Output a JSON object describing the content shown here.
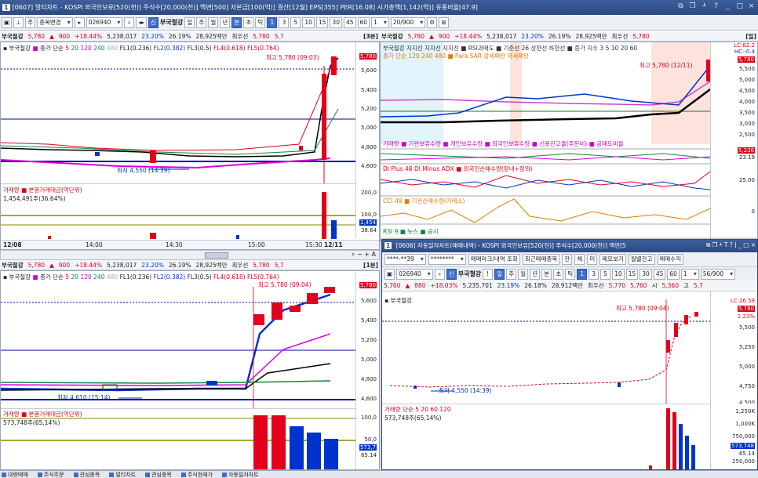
{
  "window": {
    "num": "1",
    "title": "[0607] 멀티차트 - KOSPI 외국인보유[520(천)] 주식수[20,000(천)] 액면[500] 자본금[100(억)] 결산[12월] EPS[355] PER[16.08] 시가총액[1,142(억)] 유통비율[47.9]",
    "icons": [
      "restore-icon",
      "copy-icon",
      "pin-icon",
      "help-icon",
      "minimize-icon",
      "close-icon"
    ]
  },
  "toolbar": {
    "stock_search_label": "종목변경",
    "code": "026940",
    "stock_name": "부국철강",
    "periods": [
      "일",
      "주",
      "월",
      "년",
      "분",
      "초",
      "틱"
    ],
    "minutes": [
      "1",
      "3",
      "5",
      "10",
      "15",
      "30",
      "45",
      "60"
    ],
    "unit": "1",
    "count": "20/900"
  },
  "quote": {
    "name": "부국철강",
    "price": "5,780",
    "arrow": "▲",
    "change": "900",
    "pct": "+18.44%",
    "volume": "5,238,017",
    "ratio": "23.20%",
    "turnover": "26.19%",
    "amount": "28,925백만",
    "prefer": "최우선",
    "bid": "5,780",
    "ask": "5,7"
  },
  "pane1": {
    "badge": "[3분]",
    "legend_name": "부국철강",
    "ma": [
      "종가 단순",
      "5",
      "20",
      "120",
      "240",
      "480"
    ],
    "fl": [
      "FL1(0.236)",
      "FL2(0.382)",
      "FL3(0.5)",
      "FL4(0.618)",
      "FL5(0.764)"
    ],
    "high_label": "최고 5,780 (09:03)",
    "low_label": "최저 4,550 (14:39)",
    "price_tag": "5,780",
    "y_labels": [
      "5,600",
      "5,400",
      "5,200",
      "5,000",
      "4,800",
      "4,600"
    ],
    "vol_legend": "거래량 ■ 분봉거래대금(억단위)",
    "vol_value": "1,454,491주(36.64%)",
    "vol_axis": [
      "200,0",
      "100,0"
    ],
    "vol_tags": [
      "1,454",
      "38.64"
    ],
    "x_labels": [
      "12/08",
      "14:00",
      "14:30",
      "15:00",
      "15:30",
      "12/11"
    ]
  },
  "pane2": {
    "badge": "[일]",
    "legend_line1": "부국철강 지지선 지지선 지지선 ■ RSI과매도 ■ 기준선 26 상한선 하한선 ■ 증가 지수 3 5 10 20 60",
    "legend_line2": "종가 단순 120 240 480 ■ Para SAR 강세패턴 약세패턴",
    "high_label": "최고 5,780 (12/11)",
    "price_tag": "5,780",
    "lc": "LC:82.2",
    "hc": "HC:-0.4",
    "y_labels": [
      "5,500",
      "5,000",
      "4,500",
      "4,000",
      "3,500",
      "3,000",
      "2,500"
    ],
    "sub1_legend": "거래량 ■ 기관보유수량 ■ 개인보유수량 ■ 외국인보유수량 ■ 신용잔고율(주문비) ■ 공매도비율",
    "sub1_tags": [
      "5,236",
      "23.19"
    ],
    "sub2_legend": "DI Plus 48  DI Minus  ADX ■ 외국인순매수량(장내+장외)",
    "sub2_axis": "25.00",
    "sub3_legend": "CCI 48 ■ 기관순매수량(거래소)",
    "sub3_axis": "0",
    "sub4_legend": "RSI 9 ■ 뉴스 ■ 공시"
  },
  "pane3": {
    "badge": "[1분]",
    "legend_name": "부국철강",
    "ma": [
      "종가 단순",
      "5",
      "20",
      "120",
      "240",
      "480"
    ],
    "fl": [
      "FL1(0.236)",
      "FL2(0.382)",
      "FL3(0.5)",
      "FL4(0.618)",
      "FL5(0.764)"
    ],
    "high_label": "최고 5,780 (09:04)",
    "low_label": "최저 4,610 (15:14)",
    "price_tag": "5,780",
    "y_labels": [
      "5,600",
      "5,400",
      "5,200",
      "5,000",
      "4,800",
      "4,600"
    ],
    "vol_legend": "거래량 ■ 분봉거래대금(억단위)",
    "vol_value": "573,748주(65,14%)",
    "vol_axis": [
      "100,0",
      "50,0"
    ],
    "vol_tags": [
      "573,7",
      "65.14"
    ],
    "x_label": "09:03"
  },
  "pane4": {
    "num": "1",
    "title": "[0606] 자동일자차트(매매내역) - KOSPI 외국인보유[520(천)] 주식수[20,000(천)] 액면[5",
    "account": "****-**39",
    "password": "********",
    "buttons": [
      "매매마크/내역 조회",
      "최근매매종목",
      "잔",
      "체",
      "미",
      "메모보기",
      "월별잔고",
      "매매수익"
    ],
    "code": "026940",
    "stock_name": "부국철강",
    "periods": [
      "일",
      "주",
      "월",
      "년",
      "분",
      "초",
      "틱"
    ],
    "minutes": [
      "1",
      "3",
      "5",
      "10",
      "15",
      "30",
      "45",
      "60"
    ],
    "unit": "1",
    "count": "56/900",
    "quote": {
      "price": "5,760",
      "arrow": "▲",
      "change": "880",
      "pct": "+18.03%",
      "volume": "5,235,701",
      "ratio": "23.19%",
      "turnover": "26.18%",
      "amount": "28,912백만",
      "prefer": "최우선",
      "bid": "5,770",
      "ask": "5,760",
      "s": "시",
      "sv": "5,360",
      "g": "고",
      "gv": "5,7"
    },
    "legend_name": "부국철강",
    "high_label": "최고 5,780 (09:04)",
    "low_label": "최저 4,550 (14:39)",
    "price_tag": "5,780",
    "lc": "LC:26.59",
    "pct_tag": "1.23%",
    "y_labels": [
      "5,500",
      "5,250",
      "5,000",
      "4,750",
      "4,500"
    ],
    "vol_legend": "거래량 단순 5 20 60 120",
    "vol_value": "573,748주(65,14%)",
    "vol_axis": [
      "1,250K",
      "1,000K",
      "750,000",
      "500,000",
      "250,000"
    ],
    "vol_tags": [
      "573,748",
      "65.14"
    ]
  },
  "taskbar": [
    "대량매매",
    "주식주문",
    "관심종목",
    "멀티차트",
    "관심종목",
    "주식현재가",
    "자동일자차트"
  ]
}
